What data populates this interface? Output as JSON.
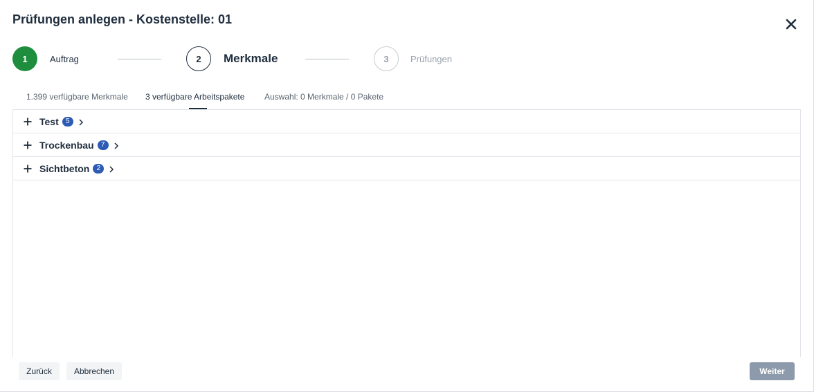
{
  "dialog": {
    "title": "Prüfungen anlegen - Kostenstelle: 01"
  },
  "stepper": {
    "steps": [
      {
        "number": "1",
        "label": "Auftrag",
        "state": "done"
      },
      {
        "number": "2",
        "label": "Merkmale",
        "state": "active"
      },
      {
        "number": "3",
        "label": "Prüfungen",
        "state": "todo"
      }
    ]
  },
  "tabs": [
    {
      "label": "1.399 verfügbare Merkmale",
      "active": false
    },
    {
      "label": "3 verfügbare Arbeitspakete",
      "active": true
    },
    {
      "label": "Auswahl: 0 Merkmale / 0 Pakete",
      "active": false
    }
  ],
  "packages": [
    {
      "name": "Test",
      "count": "5"
    },
    {
      "name": "Trockenbau",
      "count": "7"
    },
    {
      "name": "Sichtbeton",
      "count": "2"
    }
  ],
  "footer": {
    "back_label": "Zurück",
    "cancel_label": "Abbrechen",
    "next_label": "Weiter",
    "next_enabled": false
  },
  "colors": {
    "step_done": "#1e8e3e",
    "badge": "#2d5bb5",
    "primary_disabled": "#8c9aab"
  }
}
